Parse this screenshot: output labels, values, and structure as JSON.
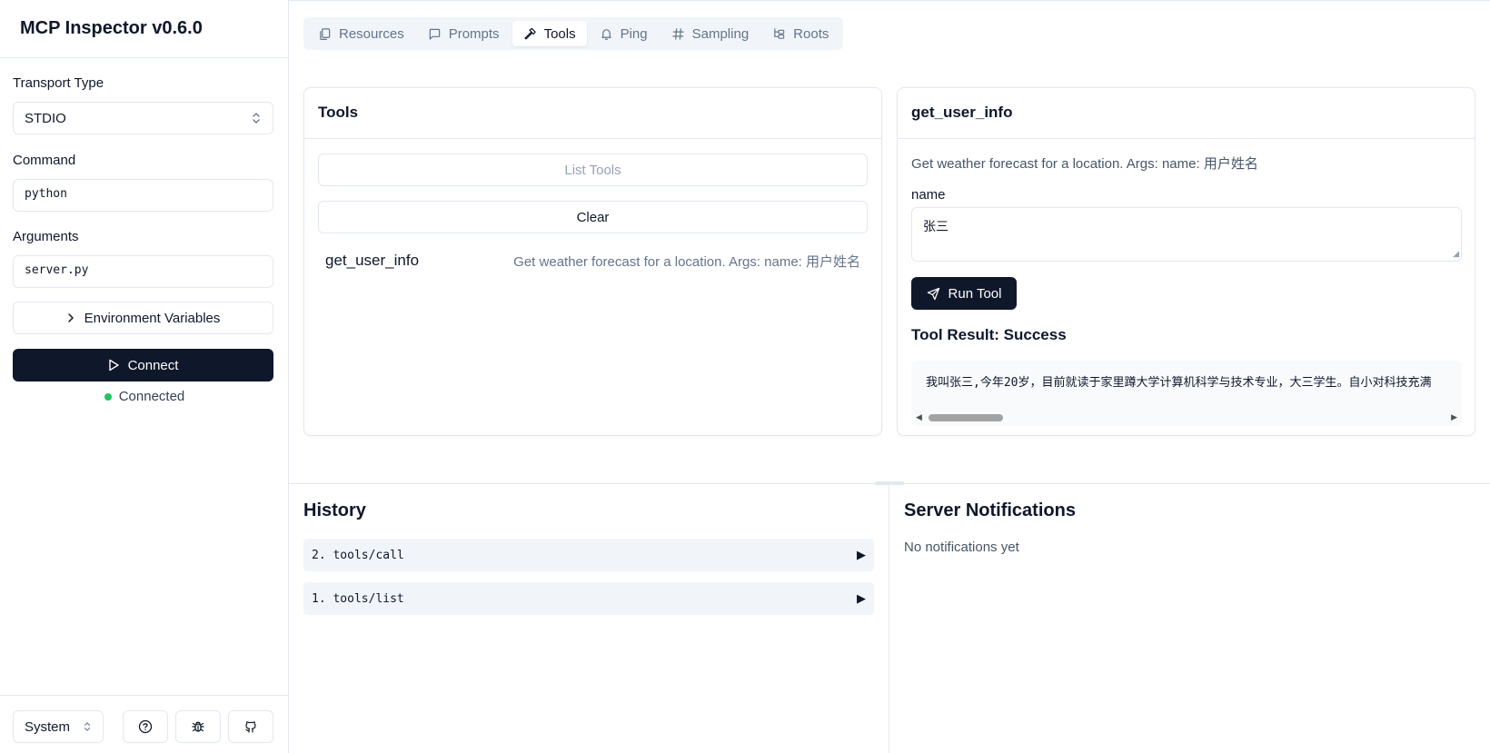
{
  "app": {
    "title": "MCP Inspector v0.6.0"
  },
  "sidebar": {
    "transport_label": "Transport Type",
    "transport_value": "STDIO",
    "command_label": "Command",
    "command_value": "python",
    "arguments_label": "Arguments",
    "arguments_value": "server.py",
    "env_button": "Environment Variables",
    "connect_button": "Connect",
    "status": "Connected",
    "theme_value": "System"
  },
  "tabs": [
    {
      "label": "Resources",
      "icon": "copy-icon",
      "active": false
    },
    {
      "label": "Prompts",
      "icon": "message-square-icon",
      "active": false
    },
    {
      "label": "Tools",
      "icon": "hammer-icon",
      "active": true
    },
    {
      "label": "Ping",
      "icon": "bell-icon",
      "active": false
    },
    {
      "label": "Sampling",
      "icon": "hash-icon",
      "active": false
    },
    {
      "label": "Roots",
      "icon": "folder-tree-icon",
      "active": false
    }
  ],
  "tools_panel": {
    "title": "Tools",
    "list_button": "List Tools",
    "clear_button": "Clear",
    "items": [
      {
        "name": "get_user_info",
        "description": "Get weather forecast for a location. Args: name: 用户姓名"
      }
    ]
  },
  "tool_detail": {
    "title": "get_user_info",
    "description": "Get weather forecast for a location. Args: name: 用户姓名",
    "param_label": "name",
    "param_value": "张三",
    "run_button": "Run Tool",
    "result_title": "Tool Result: Success",
    "result_text": "我叫张三,今年20岁，目前就读于家里蹲大学计算机科学与技术专业，大三学生。自小对科技充满"
  },
  "history": {
    "title": "History",
    "items": [
      {
        "label": "2. tools/call"
      },
      {
        "label": "1. tools/list"
      }
    ]
  },
  "notifications": {
    "title": "Server Notifications",
    "empty_text": "No notifications yet"
  },
  "colors": {
    "primary": "#0f172a",
    "border": "#e2e8f0",
    "muted": "#64748b",
    "success": "#22c55e",
    "tab_bg": "#f1f5f9"
  }
}
